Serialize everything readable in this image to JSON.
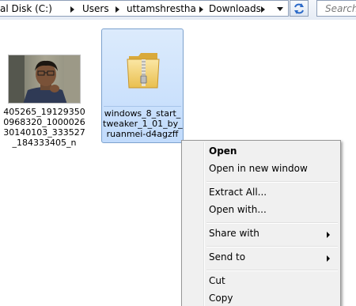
{
  "address_bar": {
    "crumbs": [
      "al Disk (C:)",
      "Users",
      "uttamshrestha",
      "Downloads"
    ]
  },
  "search": {
    "placeholder": "Search"
  },
  "files": [
    {
      "name": "405265_19129350\n0968320_1000026\n30140103_333527\n_184333405_n",
      "type": "image"
    },
    {
      "name": "windows_8_start_\ntweaker_1_01_by_\nruanmei-d4agzff",
      "type": "zip-folder",
      "selected": true
    }
  ],
  "context_menu": {
    "items": [
      {
        "label": "Open",
        "bold": true
      },
      {
        "label": "Open in new window"
      },
      {
        "label": "Extract All..."
      },
      {
        "label": "Open with..."
      },
      {
        "label": "Share with",
        "submenu": true
      },
      {
        "label": "Send to",
        "submenu": true
      },
      {
        "label": "Cut"
      },
      {
        "label": "Copy"
      }
    ]
  },
  "colors": {
    "selection_fill": "#cce0fb",
    "selection_border": "#7da2ce",
    "menu_background": "#f0f0f0"
  }
}
